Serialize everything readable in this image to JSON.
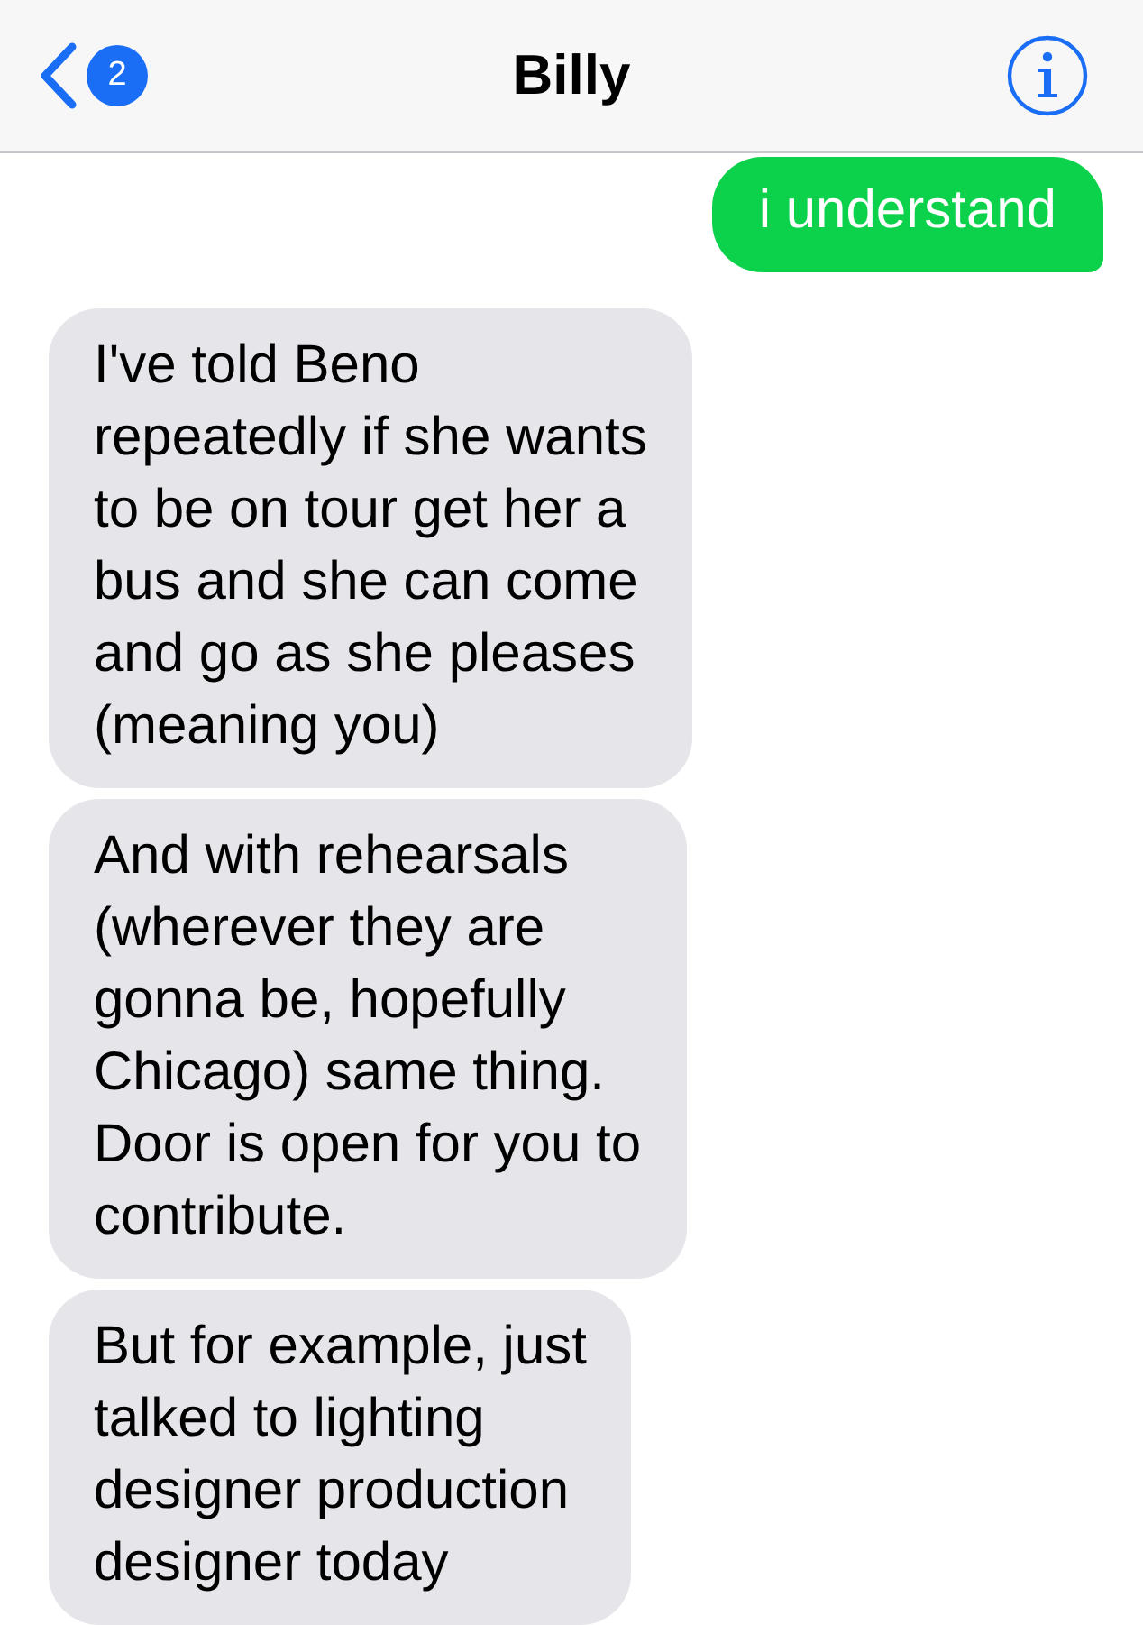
{
  "header": {
    "back_badge": "2",
    "title": "Billy"
  },
  "messages": [
    {
      "kind": "sent",
      "text": "i understand"
    },
    {
      "kind": "received",
      "text": "I've told Beno\nrepeatedly if she wants\nto be on tour get her a\nbus and she can come\nand go as she pleases\n(meaning you)"
    },
    {
      "kind": "received",
      "text": "And with rehearsals\n(wherever they are\ngonna be, hopefully\nChicago) same thing.\nDoor is open for you to\ncontribute."
    },
    {
      "kind": "received",
      "text": "But for example, just\ntalked to lighting\ndesigner production\ndesigner today"
    }
  ]
}
